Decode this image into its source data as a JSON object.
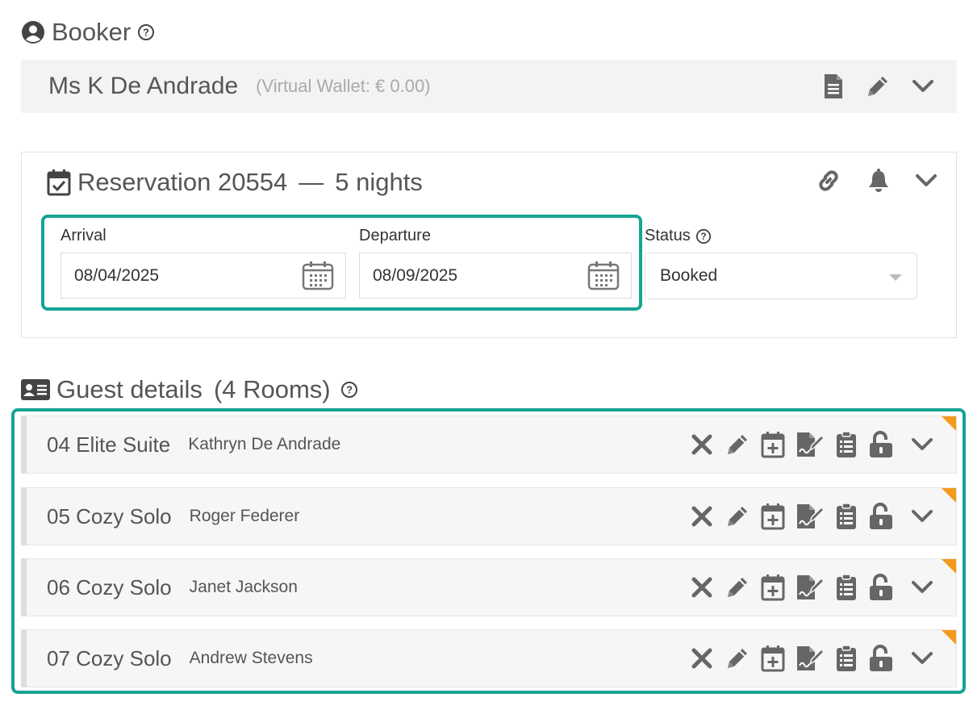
{
  "booker": {
    "heading": "Booker",
    "name": "Ms K De Andrade",
    "wallet": "(Virtual Wallet: € 0.00)"
  },
  "reservation": {
    "heading": "Reservation 20554",
    "separator": "—",
    "nights": "5 nights",
    "arrival": {
      "label": "Arrival",
      "value": "08/04/2025"
    },
    "departure": {
      "label": "Departure",
      "value": "08/09/2025"
    },
    "status": {
      "label": "Status",
      "value": "Booked"
    }
  },
  "guests": {
    "heading": "Guest details",
    "count": "(4 Rooms)",
    "rooms": [
      {
        "room": "04 Elite Suite",
        "guest": "Kathryn De Andrade"
      },
      {
        "room": "05 Cozy Solo",
        "guest": "Roger Federer"
      },
      {
        "room": "06 Cozy Solo",
        "guest": "Janet Jackson"
      },
      {
        "room": "07 Cozy Solo",
        "guest": "Andrew Stevens"
      }
    ]
  },
  "colors": {
    "highlight": "#16a394",
    "flag": "#f39a1e",
    "icon": "#666666"
  },
  "icons": [
    "user-circle-icon",
    "help-icon",
    "document-icon",
    "pencil-icon",
    "chevron-down-icon",
    "calendar-check-icon",
    "link-icon",
    "bell-icon",
    "calendar-icon",
    "id-card-icon",
    "close-icon",
    "calendar-plus-icon",
    "signature-icon",
    "clipboard-list-icon",
    "unlock-icon"
  ]
}
